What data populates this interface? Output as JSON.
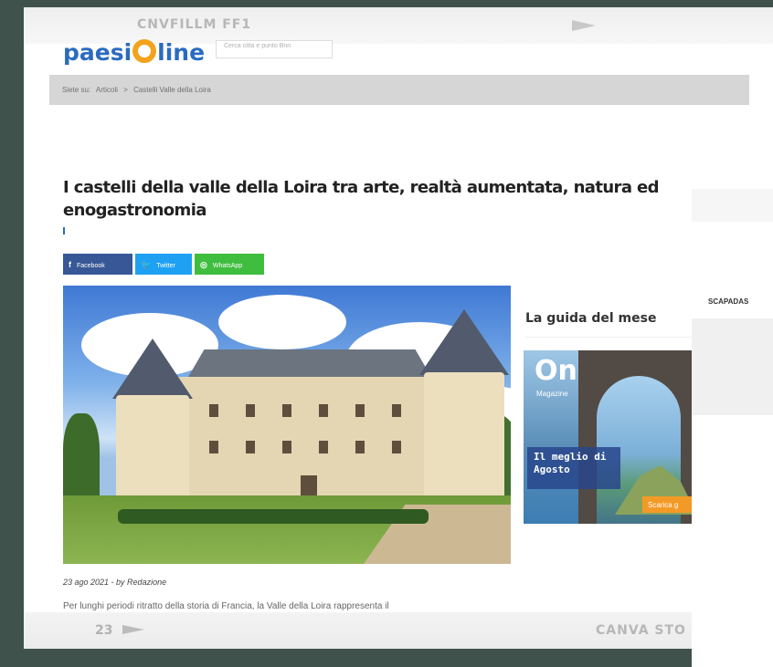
{
  "film": {
    "code_top": "CNVFILLM FF1",
    "frame_number": "23",
    "brand_bottom": "CANVA STO"
  },
  "site": {
    "logo_text": "paesi",
    "logo_text_2": "line",
    "search_placeholder": "Cerca citta e punto Bnn",
    "brand_color": "#2a6bbf",
    "accent_color": "#f4a21d"
  },
  "breadcrumb": {
    "prefix": "Siete su:",
    "items": [
      "Articoli",
      ">",
      "Castelli Valle della Loira"
    ]
  },
  "article": {
    "title": "I castelli della valle della Loira tra arte, realtà aumentata, natura ed enogastronomia",
    "date_author": "23 ago 2021 - by Redazione",
    "excerpt": "Per lunghi periodi ritratto della storia di Francia, la Valle della Loira rappresenta il"
  },
  "share": {
    "facebook_label": "Facebook",
    "twitter_label": "Twitter",
    "whatsapp_label": "WhatsApp",
    "facebook_icon": "f",
    "twitter_icon": "🐦",
    "whatsapp_icon": "◎"
  },
  "sidebar": {
    "guide_title": "La guida del mese",
    "magazine": {
      "logo": "On",
      "label": "Magazine",
      "headline": "Il meglio di Agosto",
      "button": "Scarica g"
    }
  },
  "page2": {
    "nav_text": "SCAPADAS"
  }
}
